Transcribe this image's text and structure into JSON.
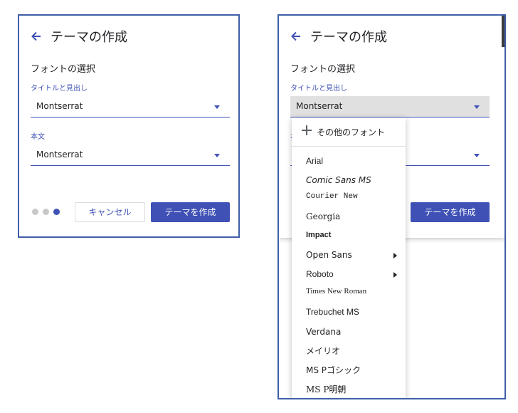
{
  "dialog": {
    "title": "テーマの作成",
    "section_label": "フォントの選択",
    "heading_field_label": "タイトルと見出し",
    "heading_font": "Montserrat",
    "body_field_label": "本文",
    "body_font": "Montserrat",
    "cancel_label": "キャンセル",
    "create_label": "テーマを作成",
    "step_current": 3,
    "step_total": 3
  },
  "menu": {
    "add_more_label": "その他のフォント",
    "items": [
      {
        "label": "Arial",
        "has_submenu": false
      },
      {
        "label": "Comic Sans MS",
        "has_submenu": false
      },
      {
        "label": "Courier New",
        "has_submenu": false
      },
      {
        "label": "Georgia",
        "has_submenu": false
      },
      {
        "label": "Impact",
        "has_submenu": false
      },
      {
        "label": "Open Sans",
        "has_submenu": true
      },
      {
        "label": "Roboto",
        "has_submenu": true
      },
      {
        "label": "Times New Roman",
        "has_submenu": false
      },
      {
        "label": "Trebuchet MS",
        "has_submenu": false
      },
      {
        "label": "Verdana",
        "has_submenu": false
      },
      {
        "label": "メイリオ",
        "has_submenu": false
      },
      {
        "label": "MS Pゴシック",
        "has_submenu": false
      },
      {
        "label": "MS P明朝",
        "has_submenu": false
      }
    ]
  },
  "icons": {
    "back": "arrow-left-icon",
    "add": "plus-icon",
    "dropdown": "triangle-down-icon",
    "submenu": "triangle-right-icon"
  },
  "colors": {
    "accent": "#3f51b5",
    "frame_border": "#3f5fa8",
    "dot_inactive": "#c8c8c8",
    "active_field_bg": "#e0e0e0"
  }
}
